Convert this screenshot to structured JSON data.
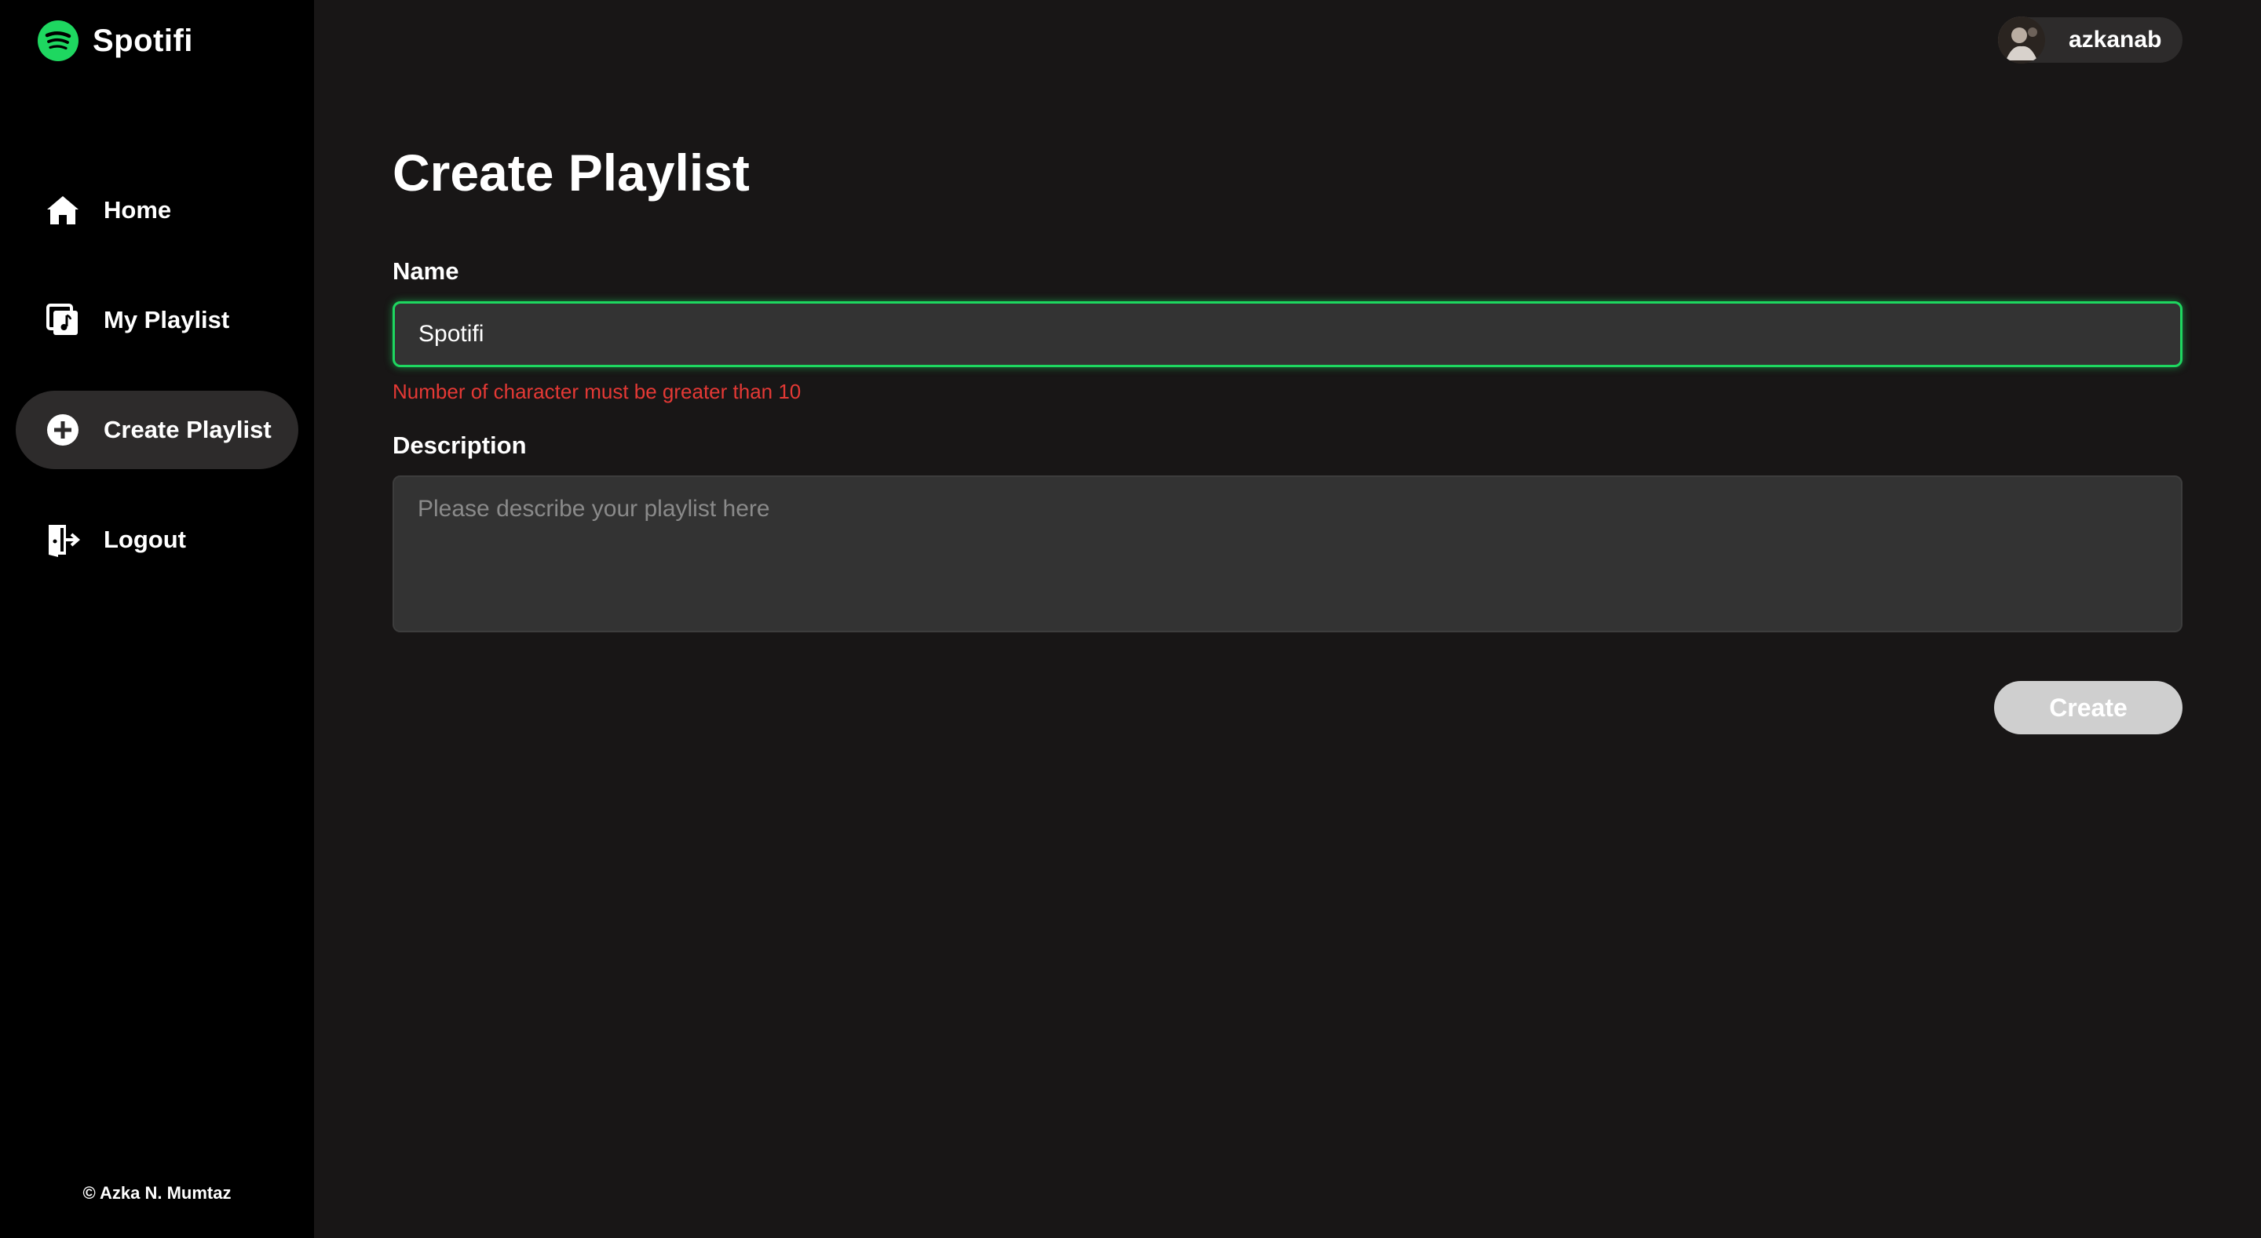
{
  "brand": {
    "name": "Spotifi",
    "color": "#1ed760"
  },
  "sidebar": {
    "items": [
      {
        "label": "Home",
        "icon": "home-icon",
        "active": false
      },
      {
        "label": "My Playlist",
        "icon": "playlist-icon",
        "active": false
      },
      {
        "label": "Create Playlist",
        "icon": "plus-circle-icon",
        "active": true
      },
      {
        "label": "Logout",
        "icon": "logout-icon",
        "active": false
      }
    ],
    "copyright": "© Azka N. Mumtaz"
  },
  "user": {
    "username": "azkanab"
  },
  "page": {
    "title": "Create Playlist"
  },
  "form": {
    "name_label": "Name",
    "name_value": "Spotifi",
    "name_error": "Number of character must be greater than 10",
    "error_color": "#e53935",
    "description_label": "Description",
    "description_value": "",
    "description_placeholder": "Please describe your playlist here",
    "submit_label": "Create"
  }
}
